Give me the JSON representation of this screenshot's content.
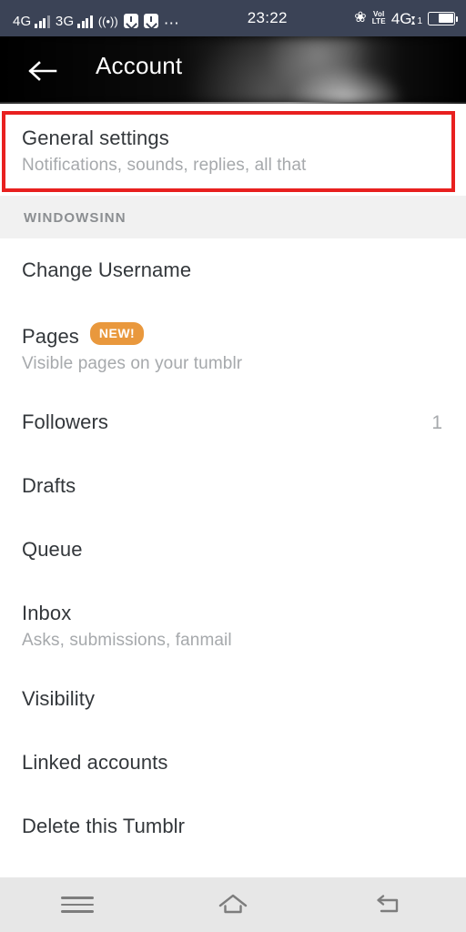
{
  "statusbar": {
    "networks": [
      {
        "label": "4G",
        "bars": 4,
        "dim": true
      },
      {
        "label": "3G",
        "bars": 4,
        "dim": false
      }
    ],
    "hotspot_icon": "hotspot-icon",
    "download_icon_1": "download-icon",
    "download_icon_2": "download-icon",
    "more_icon": "ellipsis-icon",
    "clock": "23:22",
    "bluetooth_icon": "bluetooth-icon",
    "volte_top": "VoI",
    "volte_bottom": "LTE",
    "data_label": "4G",
    "sim_index": "1",
    "battery_icon": "battery-icon",
    "battery_level": 62
  },
  "appbar": {
    "back_icon": "back-arrow-icon",
    "title": "Account"
  },
  "highlight": {
    "color": "#e8201f"
  },
  "general": {
    "title": "General settings",
    "subtitle": "Notifications, sounds, replies, all that"
  },
  "section": {
    "label": "WINDOWSINN"
  },
  "items": [
    {
      "title": "Change Username",
      "subtitle": "",
      "badge": "",
      "value": ""
    },
    {
      "title": "Pages",
      "subtitle": "Visible pages on your tumblr",
      "badge": "NEW!",
      "value": ""
    },
    {
      "title": "Followers",
      "subtitle": "",
      "badge": "",
      "value": "1"
    },
    {
      "title": "Drafts",
      "subtitle": "",
      "badge": "",
      "value": ""
    },
    {
      "title": "Queue",
      "subtitle": "",
      "badge": "",
      "value": ""
    },
    {
      "title": "Inbox",
      "subtitle": "Asks, submissions, fanmail",
      "badge": "",
      "value": ""
    },
    {
      "title": "Visibility",
      "subtitle": "",
      "badge": "",
      "value": ""
    },
    {
      "title": "Linked accounts",
      "subtitle": "",
      "badge": "",
      "value": ""
    },
    {
      "title": "Delete this Tumblr",
      "subtitle": "",
      "badge": "",
      "value": ""
    }
  ],
  "navbar": {
    "menu_icon": "menu-icon",
    "home_icon": "home-icon",
    "back_icon": "back-icon"
  }
}
